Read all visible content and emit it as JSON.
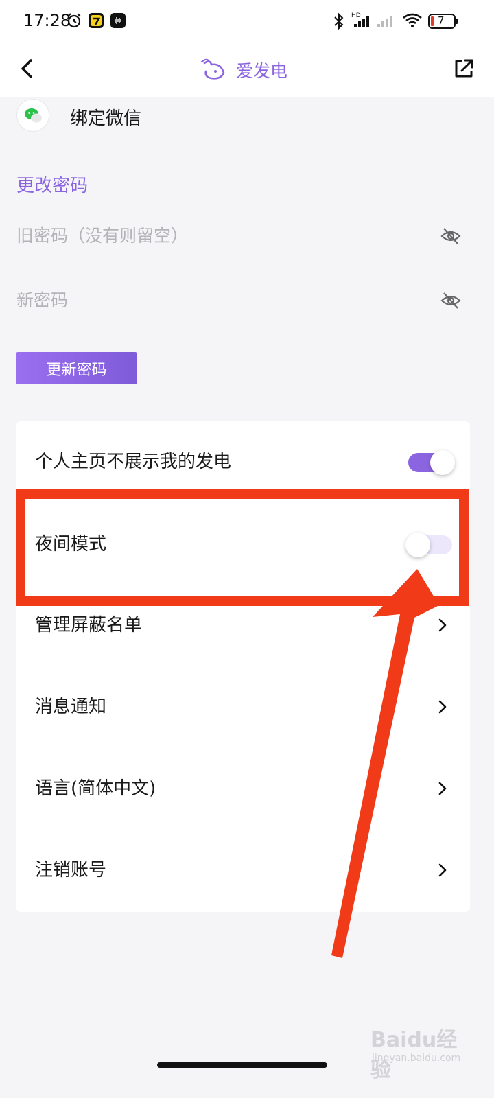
{
  "status_bar": {
    "time": "17:28",
    "battery_level": "7",
    "icons": [
      "alarm-icon",
      "app-badge-icon",
      "voice-app-icon",
      "bluetooth-icon",
      "signal-hd-icon",
      "signal-icon",
      "wifi-icon",
      "battery-icon"
    ]
  },
  "nav": {
    "title": "爱发电",
    "back_icon": "chevron-left-icon",
    "share_icon": "external-link-icon",
    "brand_color": "#8b65e0"
  },
  "account": {
    "wechat_label": "绑定微信"
  },
  "password": {
    "section_title": "更改密码",
    "old_placeholder": "旧密码（没有则留空）",
    "new_placeholder": "新密码",
    "update_button": "更新密码"
  },
  "settings": {
    "items": [
      {
        "label": "个人主页不展示我的发电",
        "control": "toggle",
        "checked": true
      },
      {
        "label": "夜间模式",
        "control": "toggle",
        "checked": false
      },
      {
        "label": "管理屏蔽名单",
        "control": "chevron"
      },
      {
        "label": "消息通知",
        "control": "chevron"
      },
      {
        "label": "语言(简体中文)",
        "control": "chevron"
      },
      {
        "label": "注销账号",
        "control": "chevron"
      }
    ]
  },
  "annotation": {
    "color": "#f03a18"
  },
  "watermark": {
    "logo": "Baidu经验",
    "url": "jingyan.baidu.com"
  }
}
